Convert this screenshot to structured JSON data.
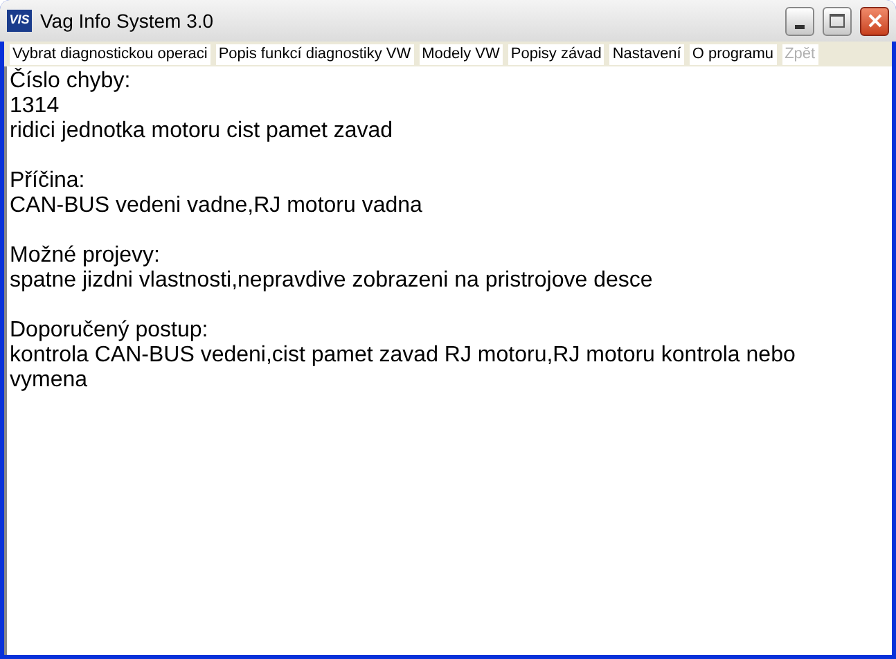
{
  "window": {
    "title": "Vag Info System 3.0",
    "app_badge": "VIS"
  },
  "menu": [
    {
      "label": "Vybrat diagnostickou operaci",
      "disabled": false
    },
    {
      "label": "Popis funkcí diagnostiky VW",
      "disabled": false
    },
    {
      "label": "Modely VW",
      "disabled": false
    },
    {
      "label": "Popisy závad",
      "disabled": false
    },
    {
      "label": "Nastavení",
      "disabled": false
    },
    {
      "label": "O programu",
      "disabled": false
    },
    {
      "label": "Zpět",
      "disabled": true
    }
  ],
  "sections": [
    {
      "heading": "Číslo chyby:",
      "lines": [
        "1314",
        "ridici jednotka motoru cist pamet zavad"
      ]
    },
    {
      "heading": "Příčina:",
      "lines": [
        "CAN-BUS vedeni vadne,RJ motoru vadna"
      ]
    },
    {
      "heading": "Možné projevy:",
      "lines": [
        "spatne jizdni vlastnosti,nepravdive zobrazeni na pristrojove desce"
      ]
    },
    {
      "heading": "Doporučený postup:",
      "lines": [
        "kontrola CAN-BUS vedeni,cist pamet zavad RJ motoru,RJ motoru kontrola nebo vymena"
      ]
    }
  ]
}
